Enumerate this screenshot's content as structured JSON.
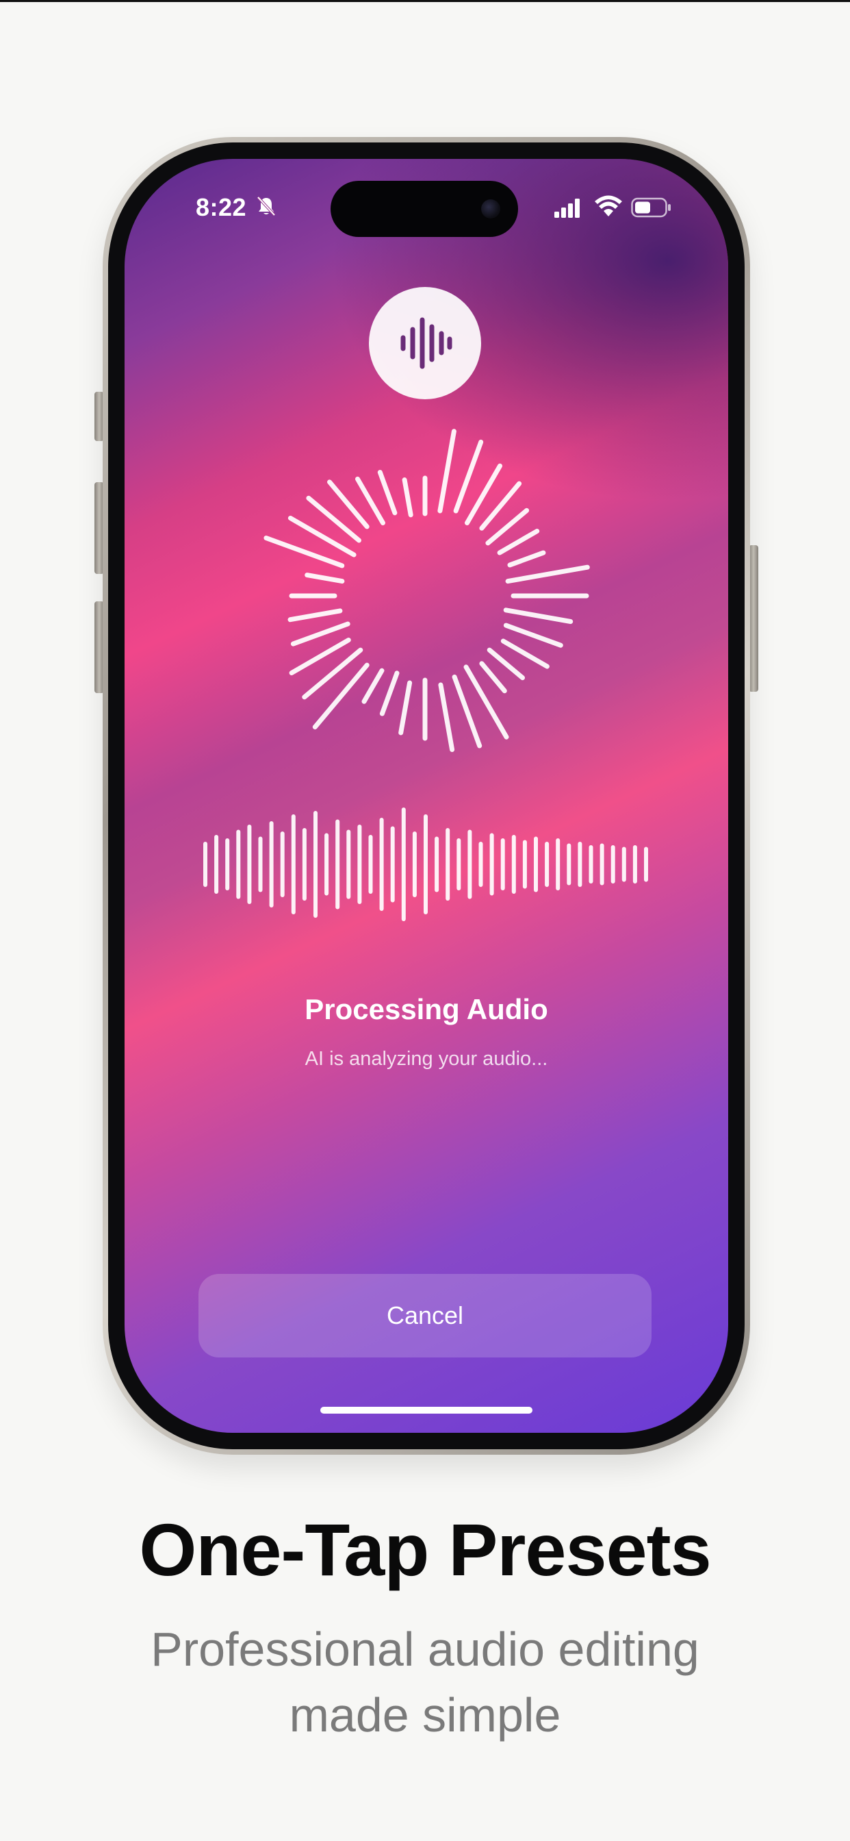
{
  "status_bar": {
    "time": "8:22",
    "icons": [
      "bell-slash-icon",
      "cellular-signal-icon",
      "wifi-icon",
      "battery-icon"
    ]
  },
  "app": {
    "logo_icon": "waveform-icon",
    "processing_title": "Processing Audio",
    "processing_subtitle": "AI is analyzing your audio...",
    "cancel_label": "Cancel"
  },
  "marketing": {
    "headline": "One-Tap Presets",
    "subheadline_line1": "Professional audio editing",
    "subheadline_line2": "made simple"
  },
  "colors": {
    "gradient_purple_dark": "#3b1f73",
    "gradient_pink": "#f0468a",
    "gradient_violet": "#6a3bd6",
    "headline": "#0a0a0a",
    "subheadline": "#7a7a7a"
  }
}
